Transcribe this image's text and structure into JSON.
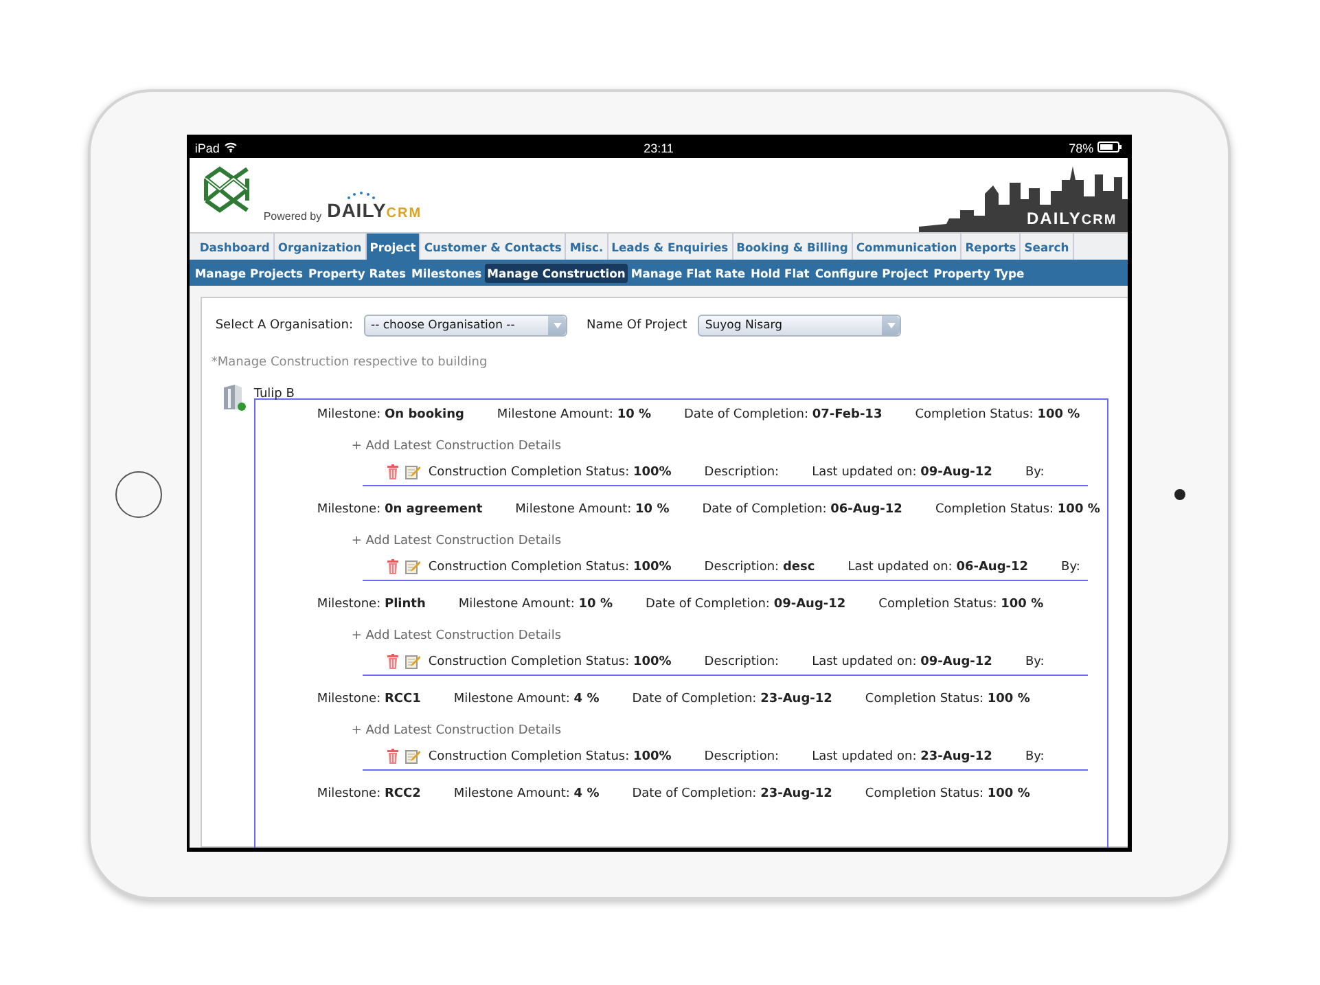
{
  "status_bar": {
    "device": "iPad",
    "time": "23:11",
    "battery": "78%"
  },
  "header": {
    "powered_by": "Powered by",
    "brand_main": "DAILY",
    "brand_suffix": "CRM",
    "banner_main": "DAILY",
    "banner_suffix": "CRM"
  },
  "tabs": [
    {
      "label": "Dashboard",
      "selected": false
    },
    {
      "label": "Organization",
      "selected": false
    },
    {
      "label": "Project",
      "selected": true
    },
    {
      "label": "Customer & Contacts",
      "selected": false
    },
    {
      "label": "Misc.",
      "selected": false
    },
    {
      "label": "Leads & Enquiries",
      "selected": false
    },
    {
      "label": "Booking & Billing",
      "selected": false
    },
    {
      "label": "Communication",
      "selected": false
    },
    {
      "label": "Reports",
      "selected": false
    },
    {
      "label": "Search",
      "selected": false
    }
  ],
  "subtabs": [
    {
      "label": "Manage Projects",
      "selected": false
    },
    {
      "label": "Property Rates",
      "selected": false
    },
    {
      "label": "Milestones",
      "selected": false
    },
    {
      "label": "Manage Construction",
      "selected": true
    },
    {
      "label": "Manage Flat Rate",
      "selected": false
    },
    {
      "label": "Hold Flat",
      "selected": false
    },
    {
      "label": "Configure Project",
      "selected": false
    },
    {
      "label": "Property Type",
      "selected": false
    }
  ],
  "form": {
    "organisation": {
      "label": "Select A Organisation:",
      "value": "-- choose Organisation --"
    },
    "project": {
      "label": "Name Of Project",
      "value": "Suyog Nisarg"
    }
  },
  "note": "*Manage Construction respective to building",
  "building": {
    "name": "Tulip B"
  },
  "milestones": [
    {
      "fields": [
        "Milestone: **On booking**",
        "Milestone Amount: **10 %**",
        "Date of Completion: **07-Feb-13**",
        "Completion Status: **100 %**"
      ],
      "add_link": "+ Add Latest Construction Details",
      "details": [
        "Construction Completion Status: **100%**",
        "Description:",
        "Last updated on: **09-Aug-12**",
        "By:"
      ]
    },
    {
      "fields": [
        "Milestone: **0n agreement**",
        "Milestone Amount: **10 %**",
        "Date of Completion: **06-Aug-12**",
        "Completion Status: **100 %**"
      ],
      "add_link": "+ Add Latest Construction Details",
      "details": [
        "Construction Completion Status: **100%**",
        "Description: **desc**",
        "Last updated on: **06-Aug-12**",
        "By:"
      ]
    },
    {
      "fields": [
        "Milestone: **Plinth**",
        "Milestone Amount: **10 %**",
        "Date of Completion: **09-Aug-12**",
        "Completion Status: **100 %**"
      ],
      "add_link": "+ Add Latest Construction Details",
      "details": [
        "Construction Completion Status: **100%**",
        "Description:",
        "Last updated on: **09-Aug-12**",
        "By:"
      ]
    },
    {
      "fields": [
        "Milestone: **RCC1**",
        "Milestone Amount: **4 %**",
        "Date of Completion: **23-Aug-12**",
        "Completion Status: **100 %**"
      ],
      "add_link": "+ Add Latest Construction Details",
      "details": [
        "Construction Completion Status: **100%**",
        "Description:",
        "Last updated on: **23-Aug-12**",
        "By:"
      ]
    },
    {
      "fields": [
        "Milestone: **RCC2**",
        "Milestone Amount: **4 %**",
        "Date of Completion: **23-Aug-12**",
        "Completion Status: **100 %**"
      ]
    }
  ]
}
